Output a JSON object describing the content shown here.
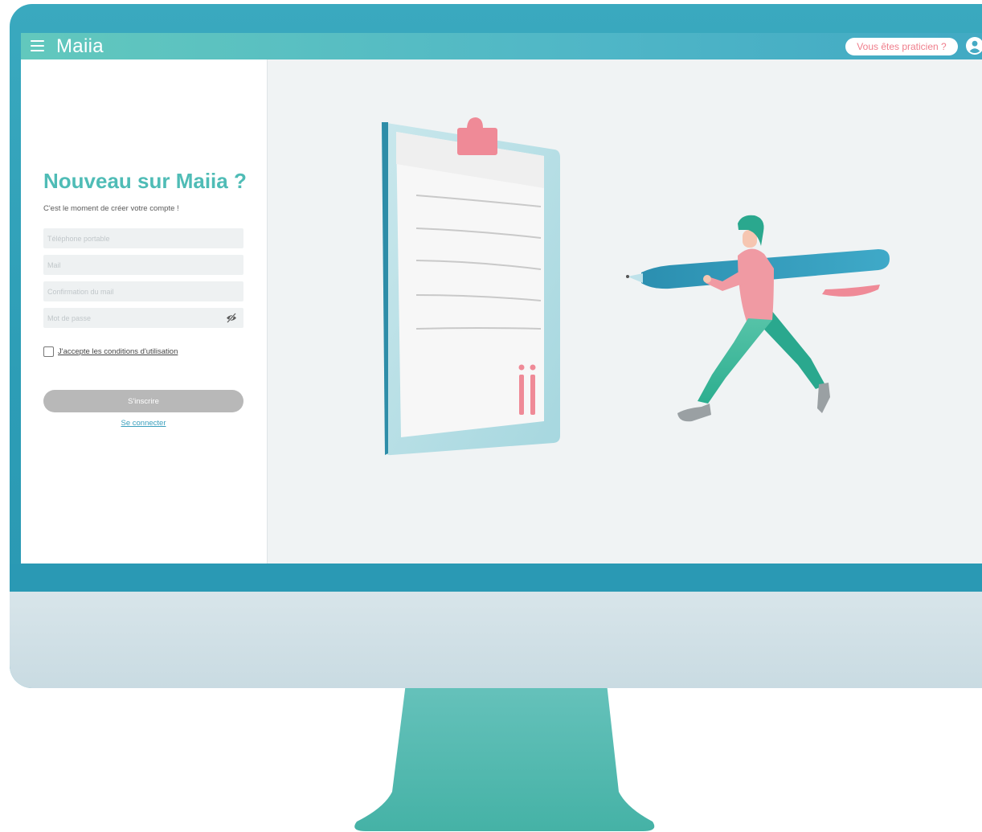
{
  "header": {
    "brand": "Maiia",
    "practitioner_button": "Vous êtes praticien ?"
  },
  "signup": {
    "title": "Nouveau sur Maiia ?",
    "subtitle": "C'est le moment de créer votre compte !",
    "phone_placeholder": "Téléphone portable",
    "mail_placeholder": "Mail",
    "mail_confirm_placeholder": "Confirmation du mail",
    "password_placeholder": "Mot de passe",
    "terms_label": "J'accepte les conditions d'utilisation",
    "submit_label": "S'inscrire",
    "login_link": "Se connecter"
  },
  "colors": {
    "brand_teal": "#4fbcb6",
    "accent_pink": "#ef7e8c",
    "monitor_blue": "#2d9db6",
    "button_grey": "#b8b8b8"
  },
  "icons": [
    "menu-icon",
    "user-icon",
    "eye-off-icon"
  ]
}
